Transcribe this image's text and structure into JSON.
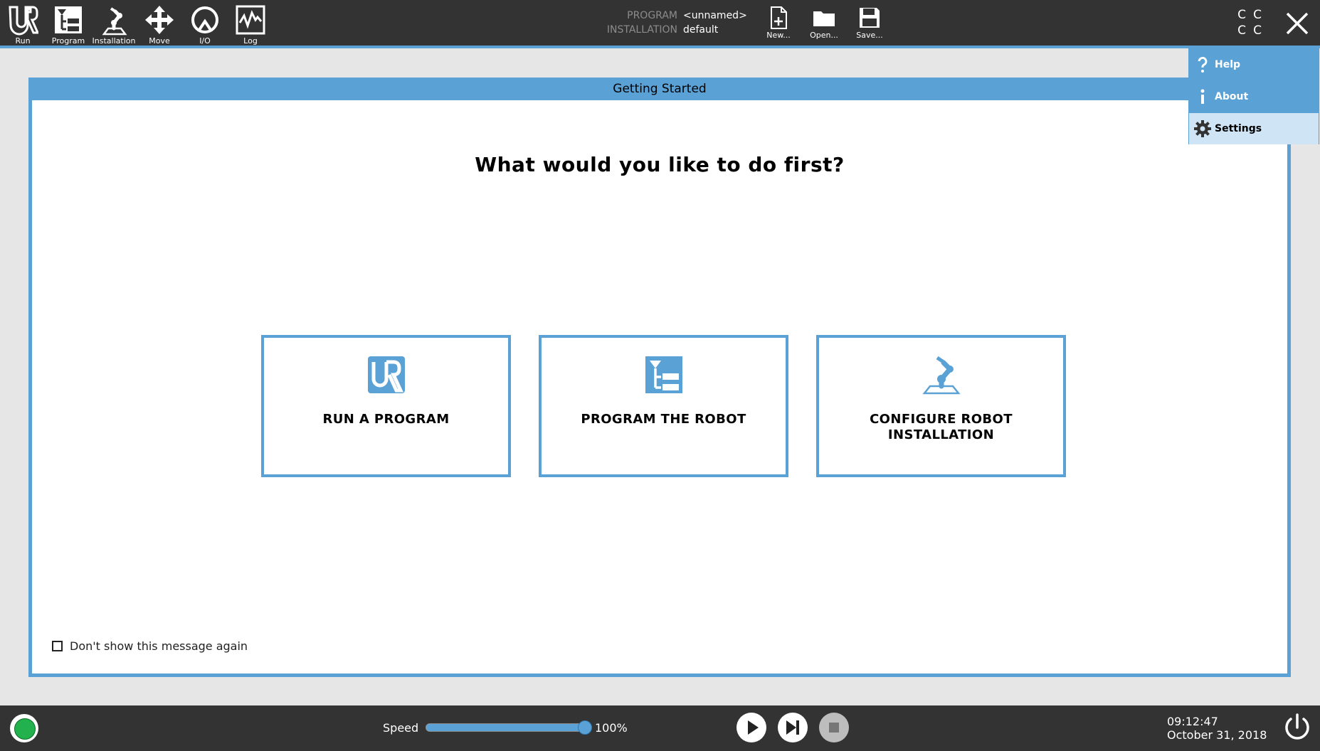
{
  "toolbar": {
    "tabs": [
      {
        "label": "Run",
        "icon": "ur-logo-icon"
      },
      {
        "label": "Program",
        "icon": "program-tree-icon"
      },
      {
        "label": "Installation",
        "icon": "robot-arm-icon"
      },
      {
        "label": "Move",
        "icon": "move-arrows-icon"
      },
      {
        "label": "I/O",
        "icon": "io-icon"
      },
      {
        "label": "Log",
        "icon": "log-graph-icon"
      }
    ],
    "program_key": "PROGRAM",
    "program_value": "<unnamed>",
    "installation_key": "INSTALLATION",
    "installation_value": "default",
    "file_buttons": [
      {
        "label": "New...",
        "icon": "new-file-icon"
      },
      {
        "label": "Open...",
        "icon": "open-folder-icon"
      },
      {
        "label": "Save...",
        "icon": "save-disk-icon"
      }
    ],
    "cc_letters": [
      "C",
      "C",
      "C",
      "C"
    ]
  },
  "menu": {
    "items": [
      {
        "label": "Help",
        "icon": "help-icon"
      },
      {
        "label": "About",
        "icon": "info-icon"
      },
      {
        "label": "Settings",
        "icon": "gear-icon",
        "selected": true
      }
    ]
  },
  "dialog": {
    "title": "Getting Started",
    "question": "What would you like to do first?",
    "choices": [
      {
        "label": "RUN A PROGRAM",
        "icon": "ur-logo-icon"
      },
      {
        "label": "PROGRAM THE ROBOT",
        "icon": "program-tree-icon"
      },
      {
        "label": "CONFIGURE ROBOT INSTALLATION",
        "icon": "robot-arm-icon"
      }
    ],
    "dont_show_label": "Don't show this message again",
    "dont_show_checked": false
  },
  "bottombar": {
    "status_color": "#22b14c",
    "speed_label": "Speed",
    "speed_value_text": "100%",
    "speed_fraction": 1.0,
    "time": "09:12:47",
    "date": "October 31, 2018"
  },
  "colors": {
    "accent": "#5aa1d6",
    "bar": "#333333",
    "background": "#e6e6e6"
  }
}
